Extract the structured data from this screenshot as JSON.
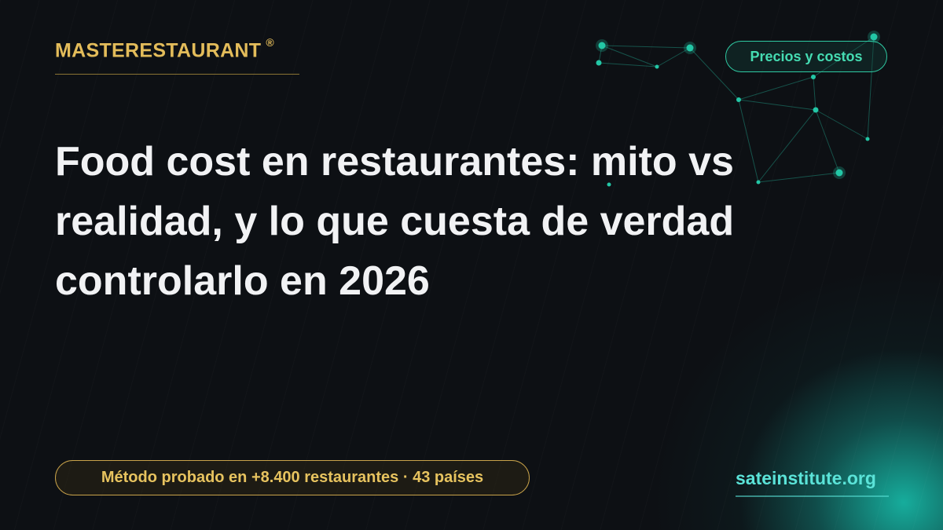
{
  "brand": {
    "name": "MASTERESTAURANT",
    "mark": "®"
  },
  "tag": {
    "label": "Precios y costos"
  },
  "headline": {
    "text": "Food cost en restaurantes: mito vs realidad, y lo que cuesta de verdad controlarlo en 2026"
  },
  "badge": {
    "text": "Método probado en +8.400 restaurantes · 43 países"
  },
  "footer": {
    "site": "sateinstitute.org"
  },
  "colors": {
    "background": "#0d1014",
    "brand_gold": "#e3bc5a",
    "accent_teal": "#45dcb2",
    "site_cyan": "#5be3d8",
    "headline": "#f1f2f4"
  }
}
